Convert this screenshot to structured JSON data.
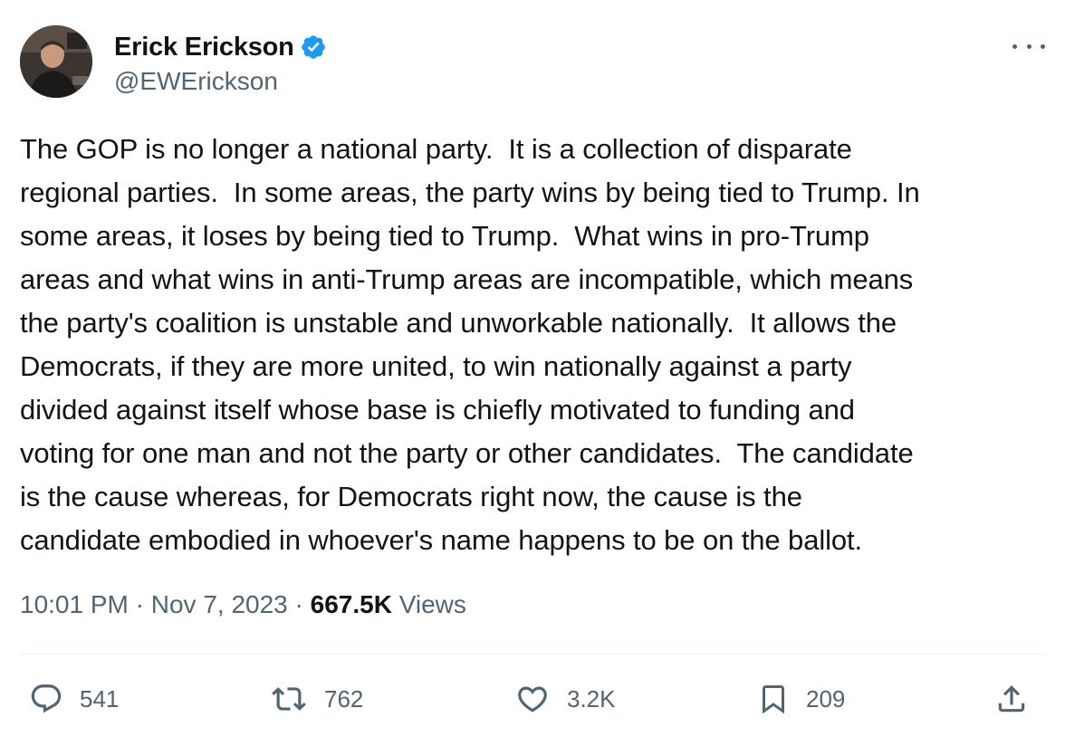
{
  "author": {
    "display_name": "Erick Erickson",
    "handle": "@EWErickson",
    "verified": true,
    "avatar_icon": "profile-photo"
  },
  "tweet": {
    "text": "The GOP is no longer a national party.  It is a collection of disparate\nregional parties.  In some areas, the party wins by being tied to Trump. In\nsome areas, it loses by being tied to Trump.  What wins in pro-Trump\nareas and what wins in anti-Trump areas are incompatible, which means\nthe party's coalition is unstable and unworkable nationally.  It allows the\nDemocrats, if they are more united, to win nationally against a party\ndivided against itself whose base is chiefly motivated to funding and\nvoting for one man and not the party or other candidates.  The candidate\nis the cause whereas, for Democrats right now, the cause is the\ncandidate embodied in whoever's name happens to be on the ballot."
  },
  "meta": {
    "time": "10:01 PM",
    "separator": " · ",
    "date": "Nov 7, 2023",
    "views_count": "667.5K",
    "views_label": " Views"
  },
  "actions": {
    "replies": "541",
    "reposts": "762",
    "likes": "3.2K",
    "bookmarks": "209"
  },
  "colors": {
    "text": "#0f1419",
    "secondary": "#536471",
    "verified": "#1d9bf0",
    "divider": "#eff3f4"
  }
}
